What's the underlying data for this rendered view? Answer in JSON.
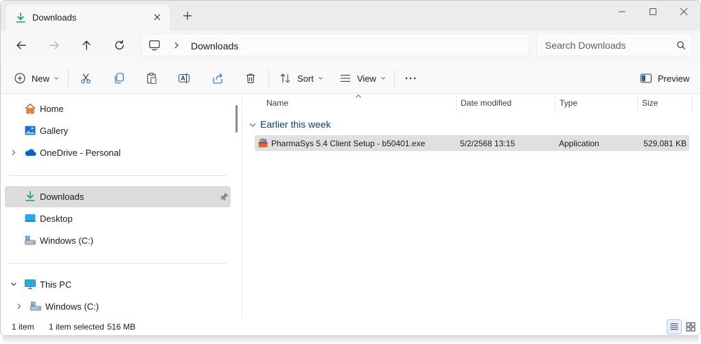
{
  "tab": {
    "title": "Downloads",
    "icon": "download-icon"
  },
  "address": {
    "crumbs": [
      "Downloads"
    ]
  },
  "search": {
    "placeholder": "Search Downloads"
  },
  "toolbar": {
    "new_label": "New",
    "sort_label": "Sort",
    "view_label": "View",
    "preview_label": "Preview",
    "icons": [
      "cut-icon",
      "copy-icon",
      "paste-icon",
      "rename-icon",
      "share-icon",
      "delete-icon",
      "more-icon"
    ]
  },
  "nav": {
    "items": [
      {
        "label": "Home"
      },
      {
        "label": "Gallery"
      },
      {
        "label": "OneDrive - Personal"
      },
      {
        "label": "Downloads"
      },
      {
        "label": "Desktop"
      },
      {
        "label": "Windows (C:)"
      },
      {
        "label": "This PC"
      },
      {
        "label": "Windows (C:)"
      }
    ]
  },
  "columns": {
    "name": "Name",
    "date": "Date modified",
    "type": "Type",
    "size": "Size"
  },
  "group": {
    "label": "Earlier this week"
  },
  "files": [
    {
      "name": "PharmaSys 5.4 Client Setup - b50401.exe",
      "date": "5/2/2568 13:15",
      "type": "Application",
      "size": "529,081 KB"
    }
  ],
  "status": {
    "count": "1 item",
    "selected": "1 item selected",
    "size": "516 MB"
  },
  "colors": {
    "accent": "#0067c0",
    "download_green": "#1a9e62",
    "group_text": "#003e92",
    "selection": "#e0e0e0"
  }
}
